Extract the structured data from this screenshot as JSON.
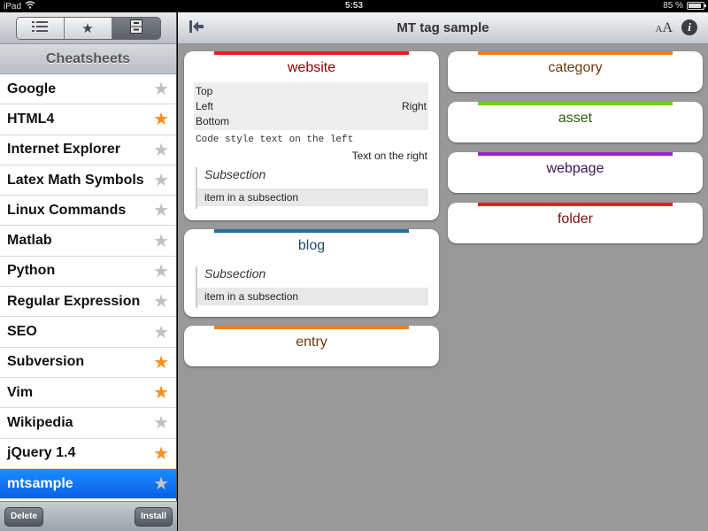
{
  "status": {
    "device": "iPad",
    "time": "5:53",
    "battery": "85 %",
    "battery_level": 0.85
  },
  "sidebar": {
    "segments": [
      {
        "icon": "list-icon"
      },
      {
        "icon": "star-icon"
      },
      {
        "icon": "cabinet-icon"
      }
    ],
    "active_segment": 2,
    "title": "Cheatsheets",
    "items": [
      {
        "label": "Google",
        "favorite": false
      },
      {
        "label": "HTML4",
        "favorite": true
      },
      {
        "label": "Internet Explorer",
        "favorite": false
      },
      {
        "label": "Latex Math Symbols",
        "favorite": false
      },
      {
        "label": "Linux Commands",
        "favorite": false
      },
      {
        "label": "Matlab",
        "favorite": false
      },
      {
        "label": "Python",
        "favorite": false
      },
      {
        "label": "Regular Expression",
        "favorite": false
      },
      {
        "label": "SEO",
        "favorite": false
      },
      {
        "label": "Subversion",
        "favorite": true
      },
      {
        "label": "Vim",
        "favorite": true
      },
      {
        "label": "Wikipedia",
        "favorite": false
      },
      {
        "label": "jQuery 1.4",
        "favorite": true
      },
      {
        "label": "mtsample",
        "favorite": false,
        "selected": true
      }
    ],
    "footer": {
      "delete_label": "Delete",
      "install_label": "Install"
    }
  },
  "nav": {
    "title": "MT tag sample",
    "font_large": "A",
    "font_small": "A",
    "info": "i"
  },
  "cards": {
    "website": {
      "title": "website",
      "color": "#ed1c24",
      "title_color": "#8b0000",
      "positions": {
        "top": "Top",
        "left": "Left",
        "right": "Right",
        "bottom": "Bottom"
      },
      "code_left": "Code style text on the left",
      "text_right": "Text on the right",
      "subsection": {
        "title": "Subsection",
        "item": "item in a subsection"
      }
    },
    "blog": {
      "title": "blog",
      "color": "#1f6f9e",
      "title_color": "#1c4a6e",
      "subsection": {
        "title": "Subsection",
        "item": "item in a subsection"
      }
    },
    "entry": {
      "title": "entry",
      "color": "#f07f1f",
      "title_color": "#6b3a10"
    },
    "category": {
      "title": "category",
      "color": "#f07f1f",
      "title_color": "#6b3a10"
    },
    "asset": {
      "title": "asset",
      "color": "#66d41f",
      "title_color": "#2f5a12"
    },
    "webpage": {
      "title": "webpage",
      "color": "#a020d0",
      "title_color": "#3d1550"
    },
    "folder": {
      "title": "folder",
      "color": "#ed1c24",
      "title_color": "#7a1010"
    }
  },
  "colors": {
    "selected_row": "#0a6bf0",
    "favorite_star": "#f5911e",
    "inactive_star": "#c0c0c0"
  }
}
